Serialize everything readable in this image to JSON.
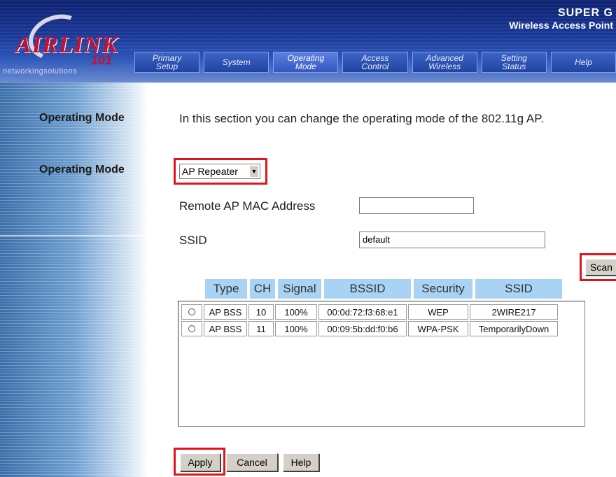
{
  "header": {
    "logo_text": "AIRLINK",
    "logo_number": "101",
    "tagline": "networkingsolutions",
    "brand_line1": "SUPER G",
    "brand_line2": "Wireless Access Point"
  },
  "tabs": [
    {
      "l1": "Primary",
      "l2": "Setup"
    },
    {
      "l1": "System",
      "l2": ""
    },
    {
      "l1": "Operating",
      "l2": "Mode"
    },
    {
      "l1": "Access",
      "l2": "Control"
    },
    {
      "l1": "Advanced",
      "l2": "Wireless"
    },
    {
      "l1": "Setting",
      "l2": "Status"
    },
    {
      "l1": "Help",
      "l2": ""
    }
  ],
  "section": {
    "title": "Operating Mode",
    "description": "In this section you can change the operating mode of the 802.11g AP.",
    "mode_label": "Operating Mode",
    "mode_value": "AP Repeater"
  },
  "form": {
    "remote_mac_label": "Remote AP MAC Address",
    "remote_mac_value": "",
    "ssid_label": "SSID",
    "ssid_value": "default",
    "scan_label": "Scan"
  },
  "scan_table": {
    "headers": [
      "Type",
      "CH",
      "Signal",
      "BSSID",
      "Security",
      "SSID"
    ],
    "rows": [
      {
        "type": "AP BSS",
        "ch": "10",
        "signal": "100%",
        "bssid": "00:0d:72:f3:68:e1",
        "security": "WEP",
        "ssid": "2WIRE217"
      },
      {
        "type": "AP BSS",
        "ch": "11",
        "signal": "100%",
        "bssid": "00:09:5b:dd:f0:b6",
        "security": "WPA-PSK",
        "ssid": "TemporarilyDown"
      }
    ]
  },
  "buttons": {
    "apply": "Apply",
    "cancel": "Cancel",
    "help": "Help"
  },
  "colors": {
    "highlight": "#e0141e",
    "table_header": "#a9d3f5"
  }
}
